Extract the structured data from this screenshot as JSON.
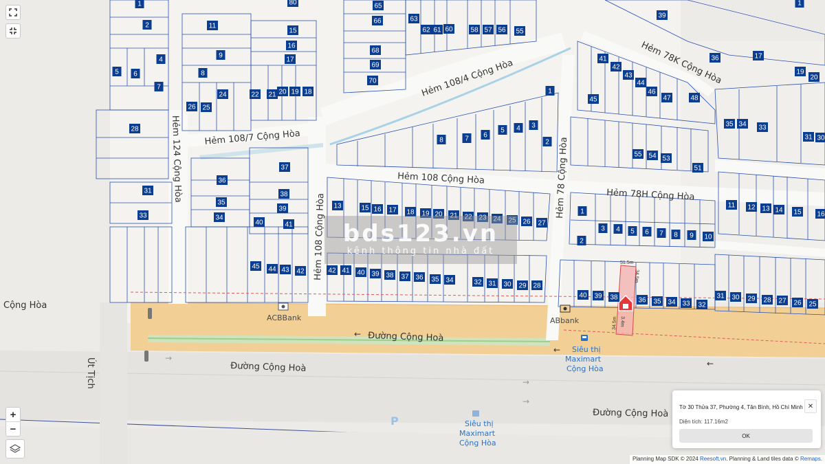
{
  "map": {
    "roads": {
      "hem_108_4": "Hẻm 108/4 Cộng Hòa",
      "hem_108_7": "Hẻm 108/7 Cộng Hòa",
      "hem_124": "Hẻm 124 Cộng Hòa",
      "hem_108": "Hẻm 108 Cộng Hòa",
      "hem_108_vertical": "Hẻm 108 Cộng Hòa",
      "hem_78": "Hẻm 78 Cộng Hòa",
      "hem_78h": "Hẻm 78H Cộng Hòa",
      "hem_78k": "Hẻm 78K Cộng Hòa",
      "duong_cong_hoa_main": "Đường Cộng Hoà",
      "duong_cong_hoa_left": "Đường Cộng Hoà",
      "duong_cong_hoa_right": "Đường Cộng Hoà",
      "cong_hoa_left": "Cộng Hòa",
      "ut_tich": "Út Tịch"
    },
    "pois": {
      "acbbank": "ACBBank",
      "abbank": "ABbank",
      "maximart_line1": "Siêu thị",
      "maximart_line2": "Maximart",
      "maximart_line3": "Cộng Hòa",
      "maximart_b_line1": "Siêu thị",
      "maximart_b_line2": "Maximart",
      "maximart_b_line3": "Cộng Hòa"
    },
    "parcel_dims": {
      "top": "51.5m",
      "left": "34.5m",
      "right": "34.5m",
      "bottom": "3.4m"
    },
    "lots": [
      {
        "label": "1"
      },
      {
        "label": "2"
      },
      {
        "label": "4"
      },
      {
        "label": "5"
      },
      {
        "label": "6"
      },
      {
        "label": "7"
      },
      {
        "label": "11"
      },
      {
        "label": "9"
      },
      {
        "label": "8"
      },
      {
        "label": "24"
      },
      {
        "label": "26"
      },
      {
        "label": "25"
      },
      {
        "label": "28"
      },
      {
        "label": "80"
      },
      {
        "label": "15"
      },
      {
        "label": "16"
      },
      {
        "label": "17"
      },
      {
        "label": "22"
      },
      {
        "label": "21"
      },
      {
        "label": "20"
      },
      {
        "label": "19"
      },
      {
        "label": "18"
      },
      {
        "label": "65"
      },
      {
        "label": "66"
      },
      {
        "label": "68"
      },
      {
        "label": "69"
      },
      {
        "label": "70"
      },
      {
        "label": "63"
      },
      {
        "label": "62"
      },
      {
        "label": "61"
      },
      {
        "label": "60"
      },
      {
        "label": "58"
      },
      {
        "label": "57"
      },
      {
        "label": "56"
      },
      {
        "label": "55"
      },
      {
        "label": "39"
      },
      {
        "label": "1"
      },
      {
        "label": "41"
      },
      {
        "label": "42"
      },
      {
        "label": "43"
      },
      {
        "label": "44"
      },
      {
        "label": "46"
      },
      {
        "label": "47"
      },
      {
        "label": "45"
      },
      {
        "label": "48"
      },
      {
        "label": "36"
      },
      {
        "label": "17"
      },
      {
        "label": "19"
      },
      {
        "label": "20"
      },
      {
        "label": "35"
      },
      {
        "label": "34"
      },
      {
        "label": "33"
      },
      {
        "label": "31"
      },
      {
        "label": "30"
      },
      {
        "label": "1"
      },
      {
        "label": "8"
      },
      {
        "label": "7"
      },
      {
        "label": "6"
      },
      {
        "label": "5"
      },
      {
        "label": "4"
      },
      {
        "label": "3"
      },
      {
        "label": "2"
      },
      {
        "label": "55"
      },
      {
        "label": "54"
      },
      {
        "label": "53"
      },
      {
        "label": "51"
      },
      {
        "label": "31"
      },
      {
        "label": "33"
      },
      {
        "label": "37"
      },
      {
        "label": "36"
      },
      {
        "label": "38"
      },
      {
        "label": "35"
      },
      {
        "label": "39"
      },
      {
        "label": "34"
      },
      {
        "label": "40"
      },
      {
        "label": "41"
      },
      {
        "label": "13"
      },
      {
        "label": "15"
      },
      {
        "label": "16"
      },
      {
        "label": "17"
      },
      {
        "label": "18"
      },
      {
        "label": "19"
      },
      {
        "label": "20"
      },
      {
        "label": "21"
      },
      {
        "label": "22"
      },
      {
        "label": "23"
      },
      {
        "label": "24"
      },
      {
        "label": "25"
      },
      {
        "label": "26"
      },
      {
        "label": "27"
      },
      {
        "label": "1"
      },
      {
        "label": "2"
      },
      {
        "label": "3"
      },
      {
        "label": "4"
      },
      {
        "label": "5"
      },
      {
        "label": "6"
      },
      {
        "label": "7"
      },
      {
        "label": "8"
      },
      {
        "label": "9"
      },
      {
        "label": "10"
      },
      {
        "label": "11"
      },
      {
        "label": "12"
      },
      {
        "label": "13"
      },
      {
        "label": "14"
      },
      {
        "label": "15"
      },
      {
        "label": "16"
      },
      {
        "label": "45"
      },
      {
        "label": "44"
      },
      {
        "label": "43"
      },
      {
        "label": "42"
      },
      {
        "label": "42"
      },
      {
        "label": "41"
      },
      {
        "label": "40"
      },
      {
        "label": "39"
      },
      {
        "label": "38"
      },
      {
        "label": "37"
      },
      {
        "label": "36"
      },
      {
        "label": "35"
      },
      {
        "label": "34"
      },
      {
        "label": "32"
      },
      {
        "label": "31"
      },
      {
        "label": "30"
      },
      {
        "label": "29"
      },
      {
        "label": "28"
      },
      {
        "label": "40"
      },
      {
        "label": "39"
      },
      {
        "label": "38"
      },
      {
        "label": "36"
      },
      {
        "label": "35"
      },
      {
        "label": "34"
      },
      {
        "label": "33"
      },
      {
        "label": "32"
      },
      {
        "label": "31"
      },
      {
        "label": "30"
      },
      {
        "label": "29"
      },
      {
        "label": "28"
      },
      {
        "label": "27"
      },
      {
        "label": "26"
      },
      {
        "label": "25"
      }
    ]
  },
  "watermark": {
    "title": "bds123.vn",
    "subtitle": "kênh thông tin nhà đất"
  },
  "popup": {
    "title": "Tờ 30 Thửa 37, Phường 4, Tân Bình, Hồ Chí Minh",
    "area": "Diện tích: 117.16m2",
    "ok_label": "OK",
    "close_label": "✕"
  },
  "controls": {
    "zoom_in": "+",
    "zoom_out": "−",
    "fullscreen_icon": "fullscreen-icon",
    "reset_icon": "fit-bounds-icon",
    "layers_icon": "layers-icon"
  },
  "attribution": {
    "prefix": "Planning Map SDK © 2024",
    "reesoft": "Reesoft.vn",
    "middle": ". Planning & Land tiles data ©",
    "remaps": "Remaps",
    "suffix": "."
  },
  "colors": {
    "lot_badge": "#0b3e91",
    "parcel_line": "#2a4fb0",
    "main_road": "#f2cf95",
    "selected_parcel": "#f2b3b3",
    "marker": "#e2383a"
  }
}
